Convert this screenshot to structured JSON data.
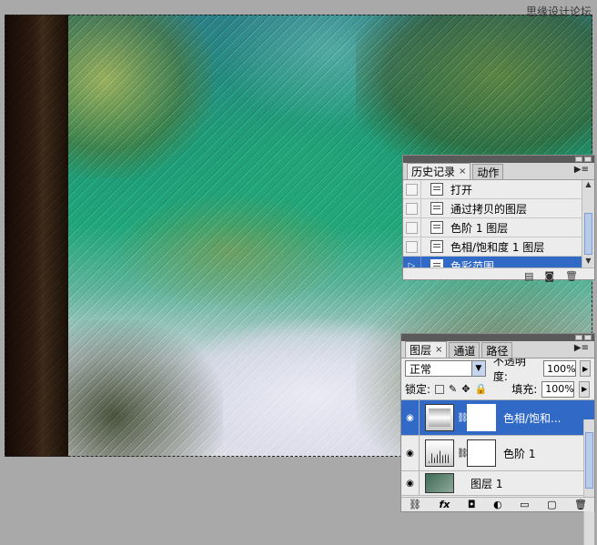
{
  "watermark": "思缘设计论坛",
  "history_panel": {
    "tabs": [
      {
        "label": "历史记录",
        "close": "×"
      },
      {
        "label": "动作"
      }
    ],
    "menu_glyph": "▶≡",
    "items": [
      {
        "label": "打开"
      },
      {
        "label": "通过拷贝的图层"
      },
      {
        "label": "色阶 1 图层"
      },
      {
        "label": "色相/饱和度 1 图层"
      },
      {
        "label": "色彩范围",
        "selected": true
      }
    ],
    "footer_icons": [
      "new-document-icon",
      "new-snapshot-icon",
      "trash-icon"
    ]
  },
  "layers_panel": {
    "tabs": [
      {
        "label": "图层",
        "close": "×"
      },
      {
        "label": "通道"
      },
      {
        "label": "路径"
      }
    ],
    "menu_glyph": "▶≡",
    "blend_mode": "正常",
    "opacity_label": "不透明度:",
    "opacity_value": "100%",
    "lock_label": "锁定:",
    "fill_label": "填充:",
    "fill_value": "100%",
    "layers": [
      {
        "name": "色相/饱和...",
        "type": "hue-saturation",
        "selected": true
      },
      {
        "name": "色阶 1",
        "type": "levels"
      },
      {
        "name": "图层 1",
        "type": "photo"
      }
    ],
    "footer_icons": [
      "link-icon",
      "fx-icon",
      "mask-icon",
      "adjustment-icon",
      "group-icon",
      "new-layer-icon",
      "trash-icon"
    ],
    "fx_label": "fx"
  },
  "colors": {
    "selection_blue": "#3169c6",
    "panel_bg": "#ececec",
    "workspace_bg": "#a9a9a9"
  }
}
